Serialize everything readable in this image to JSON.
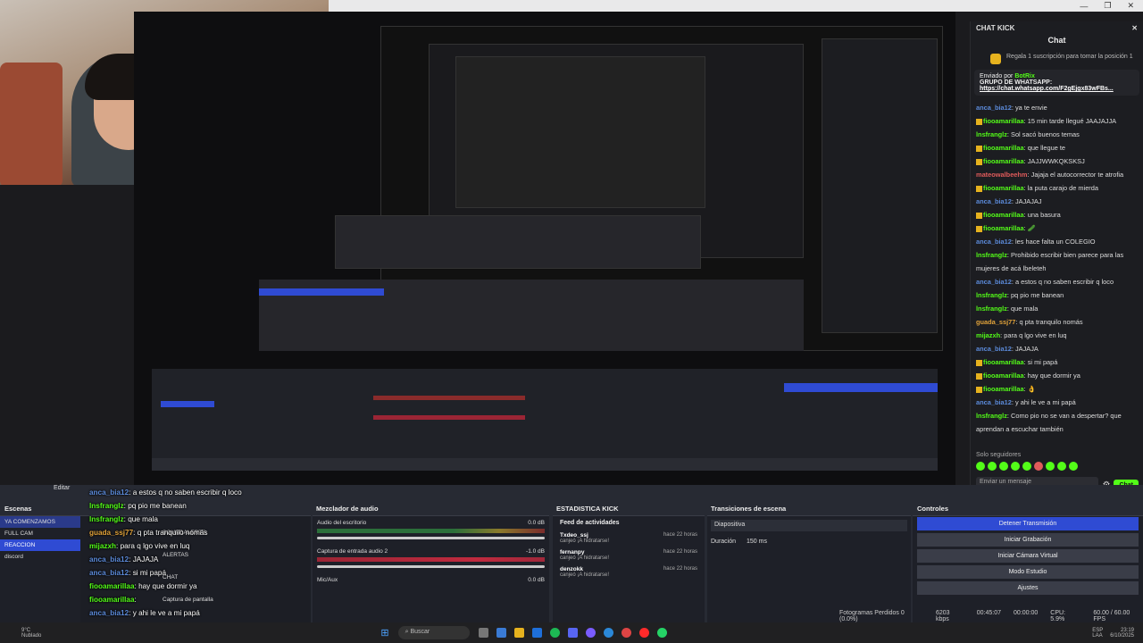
{
  "window": {
    "min": "—",
    "max": "❐",
    "close": "✕"
  },
  "chat": {
    "header": "CHAT KICK",
    "title": "Chat",
    "gift_text": "Regala 1 suscripción para tomar la posición 1",
    "pinned_by": "Enviado por",
    "pinned_user": "BotRix",
    "pinned_title": "GRUPO DE WHATSAPP:",
    "pinned_link": "https://chat.whatsapp.com/F2gEjgx83wFBs...",
    "messages": [
      {
        "user": "anca_bia12",
        "text": "ya te envie",
        "color": "#5b8ad9"
      },
      {
        "user": "fiooamarillaa",
        "text": "15 min tarde llegué JAAJAJJA",
        "color": "#53fc18",
        "badge": true
      },
      {
        "user": "lnsfranglz",
        "text": "Sol sacó buenos temas",
        "color": "#53fc18"
      },
      {
        "user": "fiooamarillaa",
        "text": "que llegue te",
        "color": "#53fc18",
        "badge": true
      },
      {
        "user": "fiooamarillaa",
        "text": "JAJJWWKQKSKSJ",
        "color": "#53fc18",
        "badge": true
      },
      {
        "user": "mateowalbeehm",
        "text": "Jajaja el autocorrector te atrofia",
        "color": "#e05b5b"
      },
      {
        "user": "fiooamarillaa",
        "text": "la puta carajo de mierda",
        "color": "#53fc18",
        "badge": true
      },
      {
        "user": "anca_bia12",
        "text": "JAJAJAJ",
        "color": "#5b8ad9"
      },
      {
        "user": "fiooamarillaa",
        "text": "una basura",
        "color": "#53fc18",
        "badge": true
      },
      {
        "user": "fiooamarillaa",
        "text": "🥒",
        "color": "#53fc18",
        "badge": true
      },
      {
        "user": "anca_bia12",
        "text": "les hace falta un COLEGIO",
        "color": "#5b8ad9"
      },
      {
        "user": "lnsfranglz",
        "text": "Prohibido escribir bien parece para las mujeres de acá lbeleteh",
        "color": "#53fc18"
      },
      {
        "user": "anca_bia12",
        "text": "a estos q no saben escribir q loco",
        "color": "#5b8ad9"
      },
      {
        "user": "lnsfranglz",
        "text": "pq pio me banean",
        "color": "#53fc18"
      },
      {
        "user": "lnsfranglz",
        "text": "que mala",
        "color": "#53fc18"
      },
      {
        "user": "guada_ssj77",
        "text": "q pta tranquilo nomás",
        "color": "#e0a23a"
      },
      {
        "user": "mijazxh",
        "text": "para q lgo vive en luq",
        "color": "#53fc18"
      },
      {
        "user": "anca_bia12",
        "text": "JAJAJA",
        "color": "#5b8ad9"
      },
      {
        "user": "fiooamarillaa",
        "text": "si mi papá",
        "color": "#53fc18",
        "badge": true
      },
      {
        "user": "fiooamarillaa",
        "text": "hay que dormir ya",
        "color": "#53fc18",
        "badge": true
      },
      {
        "user": "fiooamarillaa",
        "text": "👌",
        "color": "#53fc18",
        "badge": true
      },
      {
        "user": "anca_bia12",
        "text": "y ahi le ve a mi papá",
        "color": "#5b8ad9"
      },
      {
        "user": "lnsfranglz",
        "text": "Como pio no se van a despertar? que aprendan a escuchar también",
        "color": "#53fc18"
      }
    ],
    "followers_label": "Solo seguidores",
    "input_placeholder": "Enviar un mensaje",
    "send_label": "Chat"
  },
  "obs": {
    "editar": "Editar",
    "docks": {
      "scenes": "Escenas",
      "mixer": "Mezclador de audio",
      "stats": "ESTADISTICA KICK",
      "transitions": "Transiciones de escena",
      "controls": "Controles"
    },
    "scenes": [
      "YA COMENZAMOS",
      "FULL CAM",
      "REACCION",
      "discord"
    ],
    "sources": [
      "SOUNDALERTS",
      "ALERTAS",
      "CHAT",
      "Captura de pantalla"
    ],
    "mixer": [
      {
        "name": "Audio del escritorio",
        "db": "0.0 dB",
        "red": false
      },
      {
        "name": "Captura de entrada audio 2",
        "db": "-1.0 dB",
        "red": true
      },
      {
        "name": "Mic/Aux",
        "db": "0.0 dB",
        "red": false
      }
    ],
    "feed_title": "Feed de actividades",
    "activity": [
      {
        "user": "Txdeo_ssj",
        "action": "canjeó ¡A hidratarse!",
        "time": "hace 22 horas"
      },
      {
        "user": "fernanpy",
        "action": "canjeó ¡A hidratarse!",
        "time": "hace 22 horas"
      },
      {
        "user": "denzokk",
        "action": "canjeó ¡A hidratarse!",
        "time": "hace 22 horas"
      }
    ],
    "transition": "Diapositiva",
    "duration_label": "Duración",
    "duration_value": "150 ms",
    "controls": [
      "Detener Transmisión",
      "Iniciar Grabación",
      "Iniciar Cámara Virtual",
      "Modo Estudio",
      "Ajustes"
    ]
  },
  "overlay_chat": [
    {
      "user": "anca_bia12",
      "text": ": a estos q no saben escribir q loco",
      "color": "#5b8ad9"
    },
    {
      "user": "lnsfranglz",
      "text": ": pq pio me banean",
      "color": "#53fc18"
    },
    {
      "user": "lnsfranglz",
      "text": ": que mala",
      "color": "#53fc18"
    },
    {
      "user": "guada_ssj77",
      "text": ": q pta tranquilo nomás",
      "color": "#e0a23a"
    },
    {
      "user": "mijazxh",
      "text": ": para q lgo vive en luq",
      "color": "#53fc18"
    },
    {
      "user": "anca_bia12",
      "text": ": JAJAJA",
      "color": "#5b8ad9"
    },
    {
      "user": "anca_bia12",
      "text": ": si mi papá",
      "color": "#5b8ad9"
    },
    {
      "user": "fiooamarillaa",
      "text": ": hay que dormir ya",
      "color": "#53fc18"
    },
    {
      "user": "fiooamarillaa",
      "text": ":",
      "color": "#53fc18"
    },
    {
      "user": "anca_bia12",
      "text": ": y ahi le ve a mi papá",
      "color": "#5b8ad9"
    }
  ],
  "status": {
    "dropped": "Fotogramas Perdidos 0 (0.0%)",
    "kbps": "6203 kbps",
    "stream_time": "00:45:07",
    "rec_time": "00:00:00",
    "cpu": "CPU: 5.9%",
    "fps": "60.00 / 60.00 FPS"
  },
  "taskbar": {
    "weather_temp": "9°C",
    "weather_desc": "Nublado",
    "search": "Buscar",
    "lang1": "ESP",
    "lang2": "LAA",
    "time": "23:19",
    "date": "6/10/2025"
  },
  "colors": {
    "accent": "#2f4bd3",
    "kick_green": "#53fc18"
  }
}
